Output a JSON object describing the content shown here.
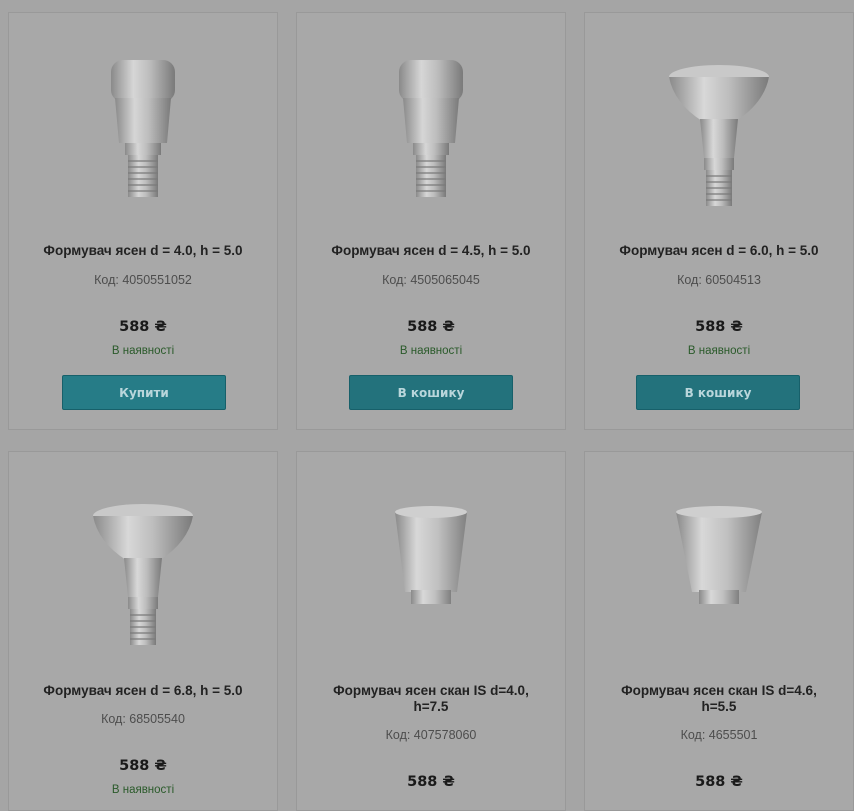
{
  "products": [
    {
      "title": "Формувач ясен d = 4.0, h = 5.0",
      "code": "Код: 4050551052",
      "price": "588 ₴",
      "stock": "В наявності",
      "button": "Купити"
    },
    {
      "title": "Формувач ясен d = 4.5, h = 5.0",
      "code": "Код: 4505065045",
      "price": "588 ₴",
      "stock": "В наявності",
      "button": "В кошику"
    },
    {
      "title": "Формувач ясен d = 6.0, h = 5.0",
      "code": "Код: 60504513",
      "price": "588 ₴",
      "stock": "В наявності",
      "button": "В кошику"
    },
    {
      "title": "Формувач ясен d = 6.8, h = 5.0",
      "code": "Код: 68505540",
      "price": "588 ₴",
      "stock": "В наявності"
    },
    {
      "title_line1": "Формувач ясен скан IS d=4.0,",
      "title_line2": "h=7.5",
      "code": "Код: 407578060",
      "price": "588 ₴"
    },
    {
      "title_line1": "Формувач ясен скан IS d=4.6,",
      "title_line2": "h=5.5",
      "code": "Код: 4655501",
      "price": "588 ₴"
    }
  ],
  "colors": {
    "overlay_bg": "#a5a5a5",
    "button_teal": "#267c87",
    "in_stock_green": "#2a5a2a"
  }
}
